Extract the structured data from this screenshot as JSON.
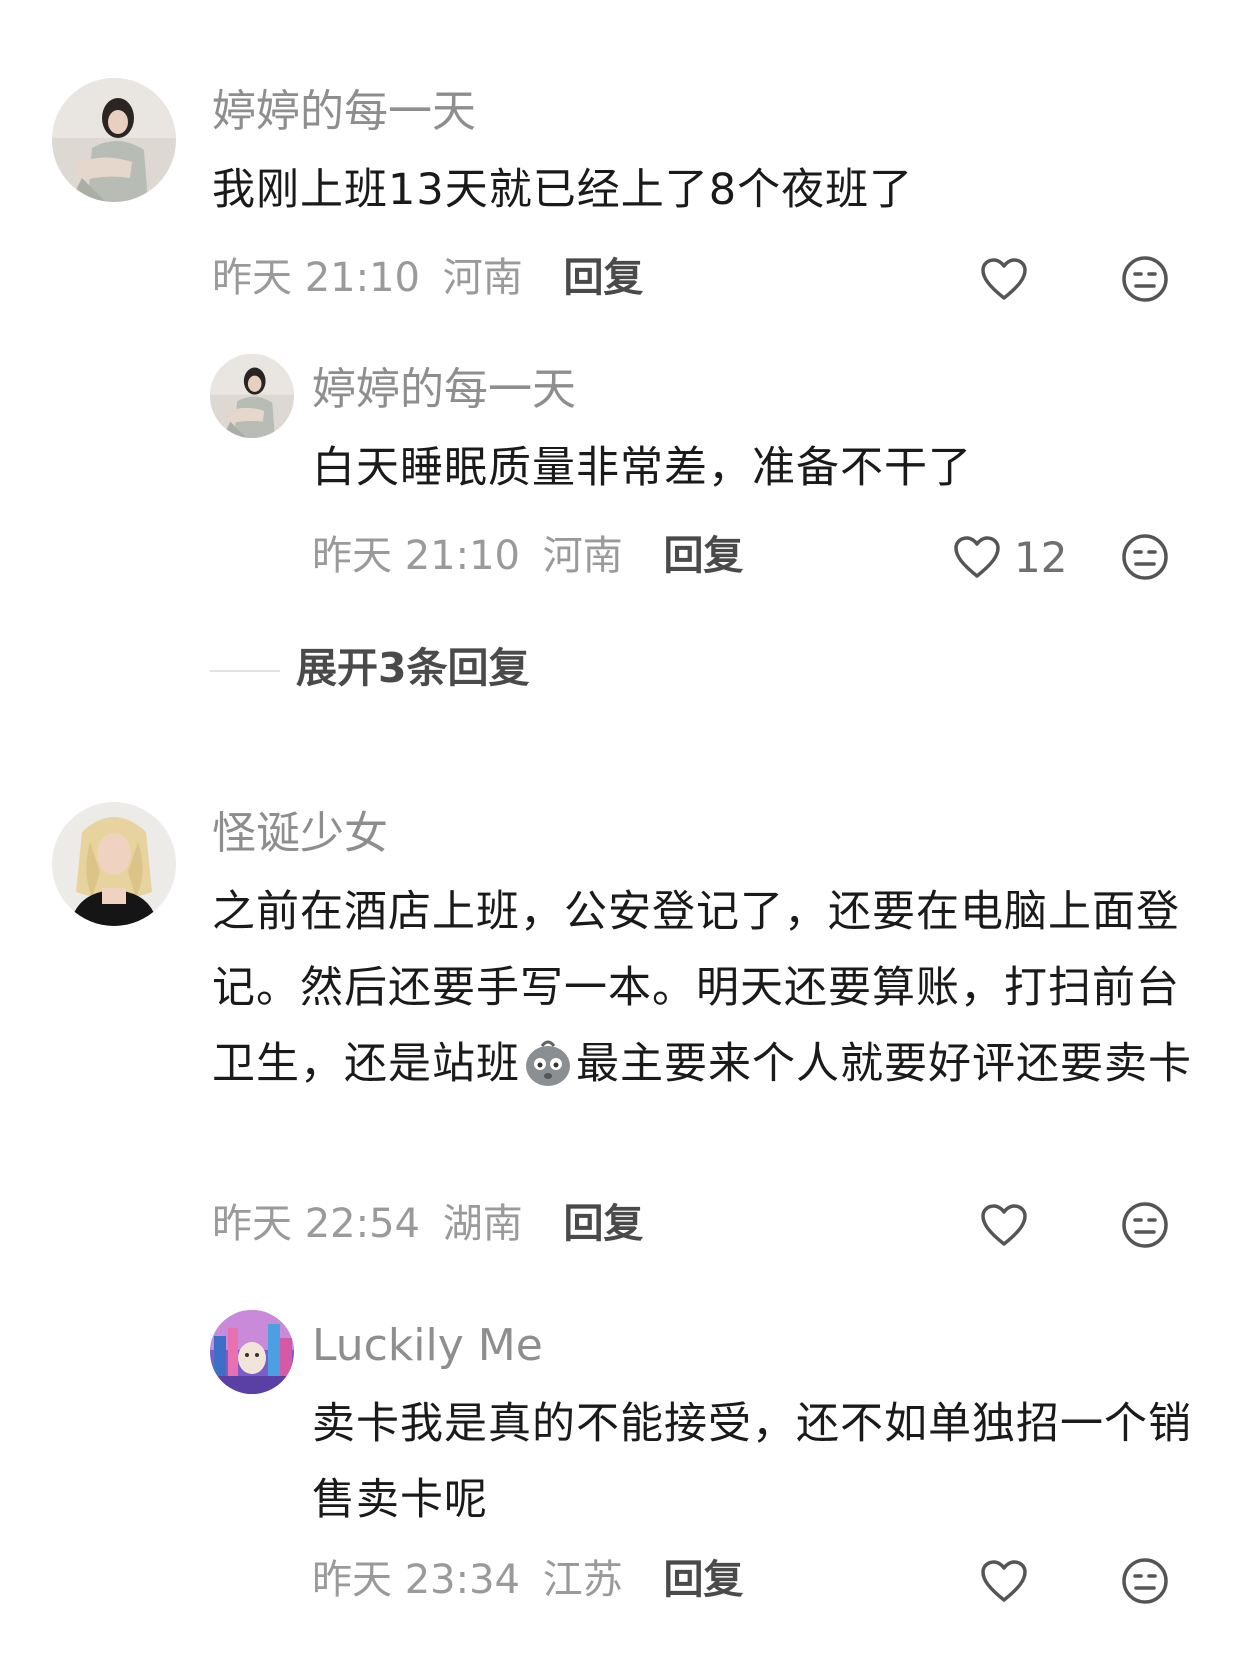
{
  "comments": [
    {
      "username": "婷婷的每一天",
      "text": "我刚上班13天就已经上了8个夜班了",
      "time": "昨天 21:10",
      "location": "河南",
      "reply_label": "回复",
      "likes": "",
      "avatar": "avatar-photo-girl-sitting",
      "replies": [
        {
          "username": "婷婷的每一天",
          "text": "白天睡眠质量非常差，准备不干了",
          "time": "昨天 21:10",
          "location": "河南",
          "reply_label": "回复",
          "likes": "12",
          "avatar": "avatar-photo-girl-sitting"
        }
      ],
      "expand_label": "展开3条回复"
    },
    {
      "username": "怪诞少女",
      "text_part1": "之前在酒店上班，公安登记了，还要在电脑上面登记。然后还要手写一本。明天还要算账，打扫前台卫生，还是站班",
      "text_part2": "最主要来个人就要好评还要卖卡",
      "inline_emoji": "exhausted-face-emoji",
      "time": "昨天 22:54",
      "location": "湖南",
      "reply_label": "回复",
      "likes": "",
      "avatar": "avatar-photo-blonde-woman",
      "replies": [
        {
          "username": "Luckily Me",
          "text": "卖卡我是真的不能接受，还不如单独招一个销售卖卡呢",
          "time": "昨天 23:34",
          "location": "江苏",
          "reply_label": "回复",
          "likes": "",
          "avatar": "avatar-colorful-city-art"
        }
      ]
    }
  ],
  "icons": {
    "like": "heart-outline-icon",
    "dislike": "meh-face-icon"
  },
  "colors": {
    "username": "#8e8e8e",
    "content": "#1a1a1a",
    "meta": "#9a9a9a",
    "reply": "#4a4a4a"
  }
}
